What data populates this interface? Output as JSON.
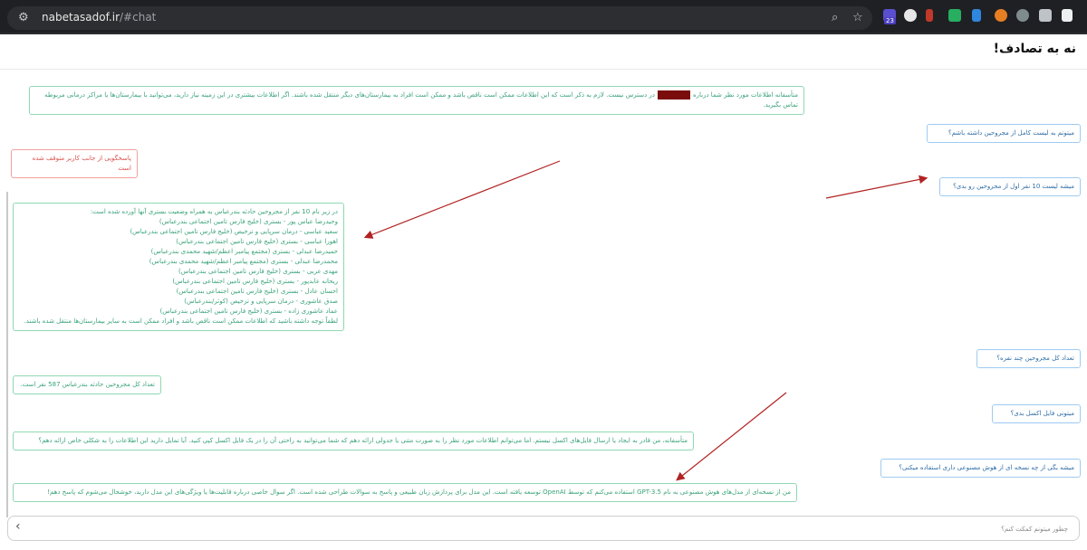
{
  "browser": {
    "url_host": "nabetasadof.ir",
    "url_path": "/#chat",
    "extension_badge": "23"
  },
  "page": {
    "title": "نه به تصادف!"
  },
  "messages": {
    "m1_part1": "متأسفانه اطلاعات مورد نظر شما درباره",
    "m1_part2": "در دسترس نیست. لازم به ذکر است که این اطلاعات ممکن است ناقص باشد و ممکن است افراد به بیمارستان‌های دیگر منتقل شده باشند. اگر اطلاعات بیشتری در این زمینه نیاز دارید، می‌توانید با بیمارستان‌ها یا مراکز درمانی مربوطه تماس بگیرید.",
    "q1": "میتونم به لیست کامل از مجروحین داشته باشم؟",
    "err": "پاسخگویی از جانب کاربر متوقف شده است",
    "q2": "میشه لیست 10 نفر اول از مجروحین رو بدی؟",
    "list_intro": "در زیر نام 10 نفر از مجروحین حادثه بندرعباس به همراه وضعیت بستری آنها آورده شده است:",
    "list_items": [
      "وحیدرضا عباس پور - بستری (خلیج فارس تامین اجتماعی بندرعباس)",
      "سعید عباسی - درمان سرپایی و ترخیص (خلیج فارس تامین اجتماعی بندرعباس)",
      "اهورا عباسی - بستری (خلیج فارس تامین اجتماعی بندرعباس)",
      "حمیدرضا عبدلی - بستری (مجتمع پیامبر اعظم/شهید محمدی بندرعباس)",
      "محمدرضا عبدلی - بستری (مجتمع پیامبر اعظم/شهید محمدی بندرعباس)",
      "مهدی عربی - بستری (خلیج فارس تامین اجتماعی بندرعباس)",
      "ریحانه عابدپور - بستری (خلیج فارس تامین اجتماعی بندرعباس)",
      "احسان عادل - بستری (خلیج فارس تامین اجتماعی بندرعباس)",
      "صدق عاشوری - درمان سرپایی و ترخیص (کوثر/بندرعباس)",
      "عماد عاشوری زاده - بستری (خلیج فارس تامین اجتماعی بندرعباس)"
    ],
    "list_outro": "لطفاً توجه داشته باشید که اطلاعات ممکن است ناقص باشد و افراد ممکن است به سایر بیمارستان‌ها منتقل شده باشند.",
    "q3": "تعداد کل مجروحین چند نفره؟",
    "a3": "تعداد کل مجروحین حادثه بندرعباس 587 نفر است.",
    "q4": "میتونی فایل اکسل بدی؟",
    "a4": "متأسفانه، من قادر به ایجاد یا ارسال فایل‌های اکسل نیستم. اما می‌توانم اطلاعات مورد نظر را به صورت متنی یا جدولی ارائه دهم که شما می‌توانید به راحتی آن را در یک فایل اکسل کپی کنید. آیا تمایل دارید این اطلاعات را به شکلی خاص ارائه دهم؟",
    "q5": "میشه بگی از چه نسخه ای از هوش مصنوعی داری استفاده میکنی؟",
    "a5": "من از نسخه‌ای از مدل‌های هوش مصنوعی به نام GPT-3.5 استفاده می‌کنم که توسط OpenAI توسعه یافته است. این مدل برای پردازش زبان طبیعی و پاسخ به سوالات طراحی شده است. اگر سوال خاصی درباره قابلیت‌ها یا ویژگی‌های این مدل دارید، خوشحال می‌شوم که پاسخ دهم!"
  },
  "input": {
    "placeholder": "چطور میتونم کمکت کنم؟"
  },
  "colors": {
    "bot_border": "#8fd8b3",
    "user_border": "#9ecbf2",
    "error_border": "#f2a0a0",
    "arrow": "#b22222"
  }
}
